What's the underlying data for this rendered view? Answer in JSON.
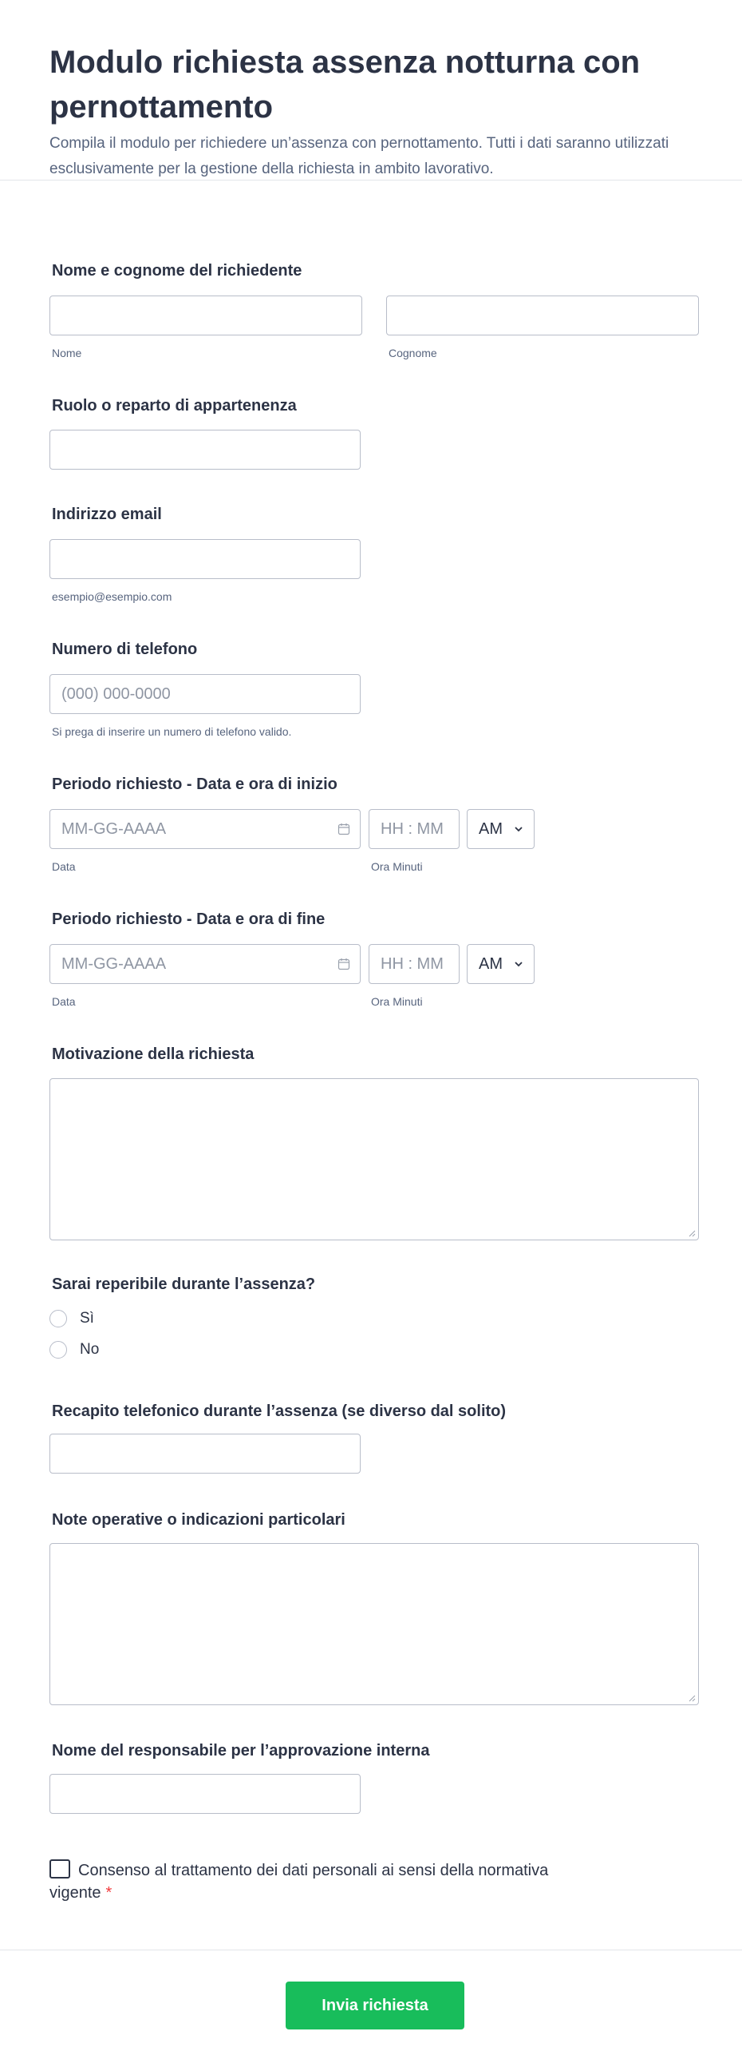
{
  "header": {
    "title": "Modulo richiesta assenza notturna con pernottamento",
    "subtitle": "Compila il modulo per richiedere un’assenza con pernottamento. Tutti i dati saranno utilizzati esclusivamente per la gestione della richiesta in ambito lavorativo."
  },
  "name": {
    "label": "Nome e cognome del richiedente",
    "first_sub": "Nome",
    "last_sub": "Cognome"
  },
  "role": {
    "label": "Ruolo o reparto di appartenenza"
  },
  "email": {
    "label": "Indirizzo email",
    "sub": "esempio@esempio.com"
  },
  "phone": {
    "label": "Numero di telefono",
    "placeholder": "(000) 000-0000",
    "sub": "Si prega di inserire un numero di telefono valido."
  },
  "start": {
    "label": "Periodo richiesto - Data e ora di inizio",
    "date_placeholder": "MM-GG-AAAA",
    "time_placeholder": "HH : MM",
    "ampm": "AM",
    "date_sub": "Data",
    "time_sub": "Ora Minuti"
  },
  "end": {
    "label": "Periodo richiesto - Data e ora di fine",
    "date_placeholder": "MM-GG-AAAA",
    "time_placeholder": "HH : MM",
    "ampm": "AM",
    "date_sub": "Data",
    "time_sub": "Ora Minuti"
  },
  "motivation": {
    "label": "Motivazione della richiesta"
  },
  "reachable": {
    "label": "Sarai reperibile durante l’assenza?",
    "options": [
      "Sì",
      "No"
    ]
  },
  "alt_phone": {
    "label": "Recapito telefonico durante l’assenza (se diverso dal solito)"
  },
  "notes": {
    "label": "Note operative o indicazioni particolari"
  },
  "manager": {
    "label": "Nome del responsabile per l’approvazione interna"
  },
  "consent": {
    "text": "Consenso al trattamento dei dati personali ai sensi della normativa vigente",
    "required_mark": "*"
  },
  "submit": {
    "label": "Invia richiesta"
  },
  "colors": {
    "accent": "#18bd5b",
    "required": "#f23a3c",
    "text": "#2c3345",
    "muted": "#57647e"
  }
}
